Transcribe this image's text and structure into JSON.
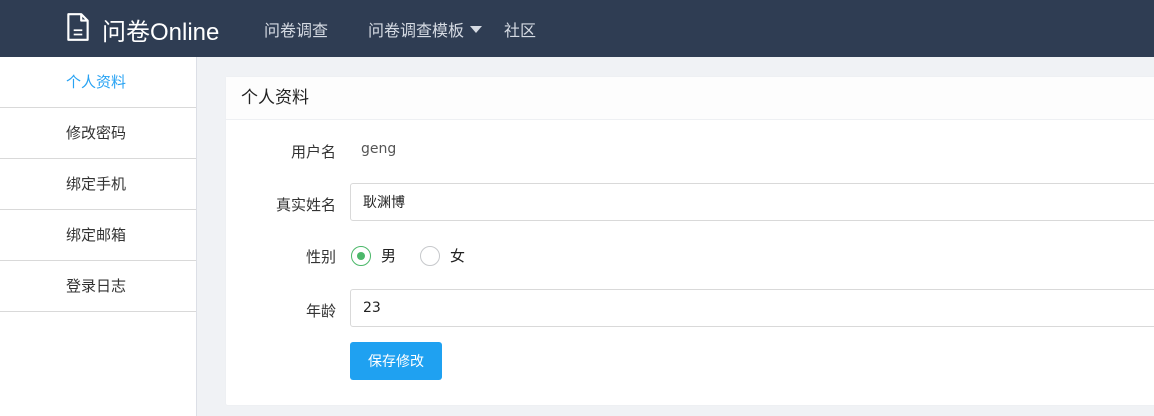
{
  "navbar": {
    "brand": "问卷Online",
    "links": [
      "问卷调查",
      "问卷调查模板",
      "社区"
    ]
  },
  "sidebar": {
    "items": [
      {
        "label": "个人资料",
        "active": true
      },
      {
        "label": "修改密码"
      },
      {
        "label": "绑定手机"
      },
      {
        "label": "绑定邮箱"
      },
      {
        "label": "登录日志"
      }
    ]
  },
  "profile": {
    "title": "个人资料",
    "username_label": "用户名",
    "username_value": "geng",
    "realname_label": "真实姓名",
    "realname_value": "耿渊博",
    "gender_label": "性别",
    "gender_options": [
      "男",
      "女"
    ],
    "gender_selected": "男",
    "age_label": "年龄",
    "age_value": "23",
    "save_label": "保存修改"
  },
  "colors": {
    "navbar_bg": "#2f3d53",
    "active_link": "#29a3f3",
    "primary_button": "#1fa1f1",
    "radio_checked": "#4cb86a"
  }
}
